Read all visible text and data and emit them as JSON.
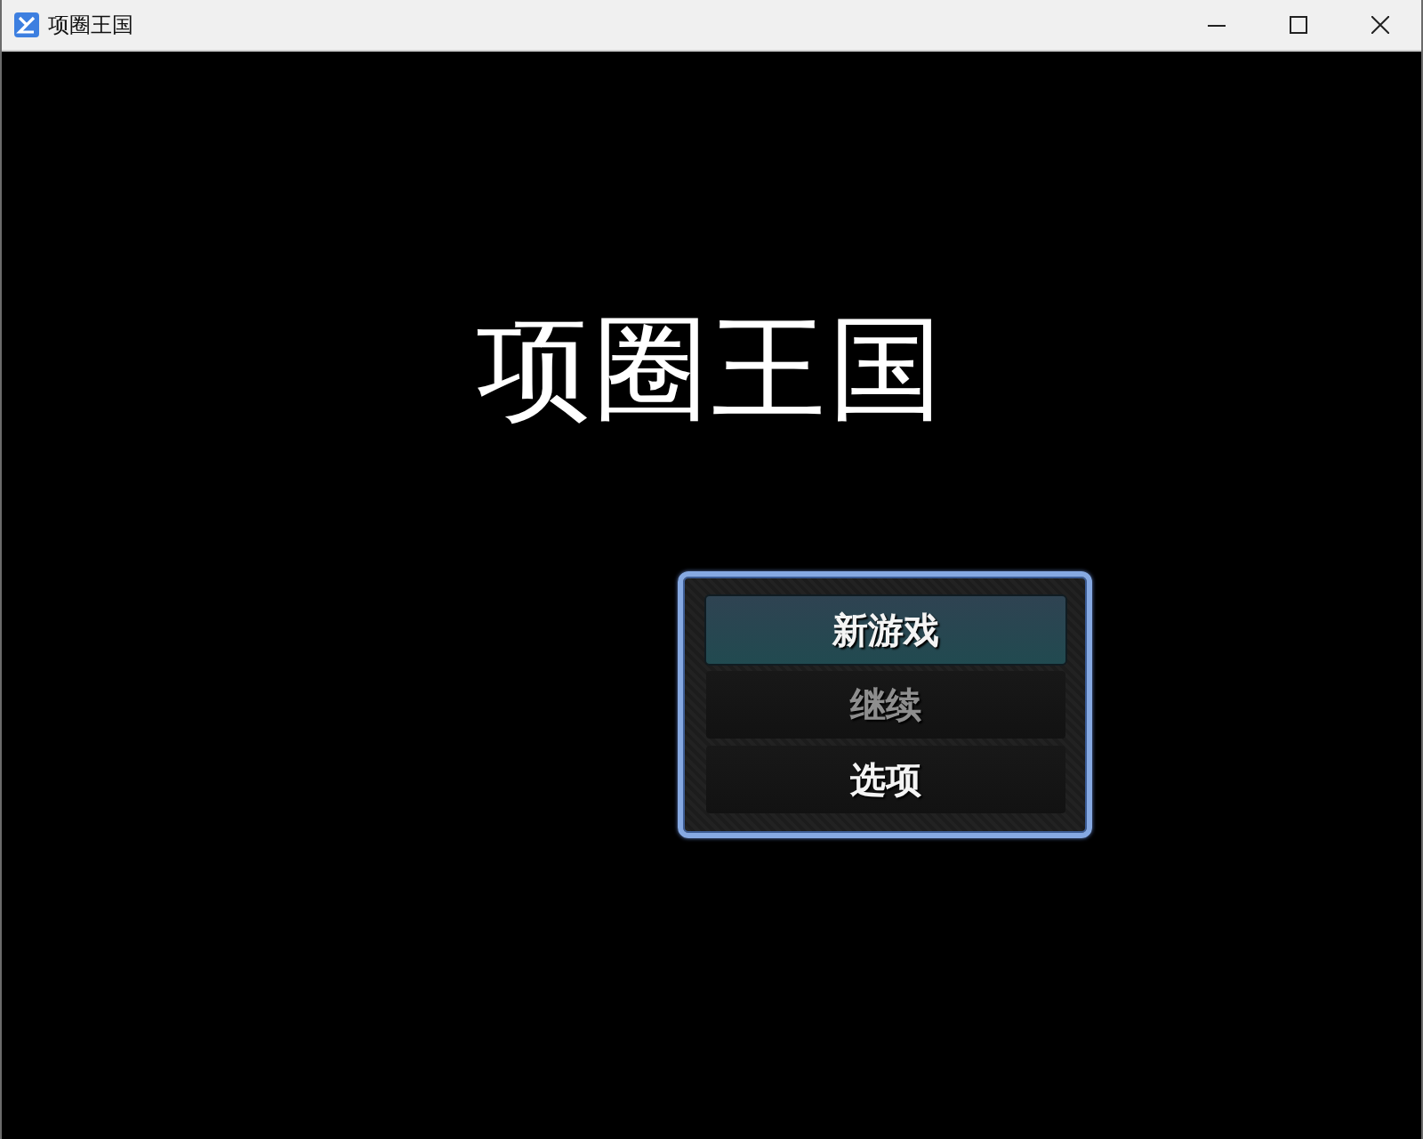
{
  "window": {
    "title": "项圈王国"
  },
  "game": {
    "title": "项圈王国",
    "menu": [
      {
        "label": "新游戏",
        "selected": true,
        "disabled": false
      },
      {
        "label": "继续",
        "selected": false,
        "disabled": true
      },
      {
        "label": "选项",
        "selected": false,
        "disabled": false
      }
    ]
  }
}
